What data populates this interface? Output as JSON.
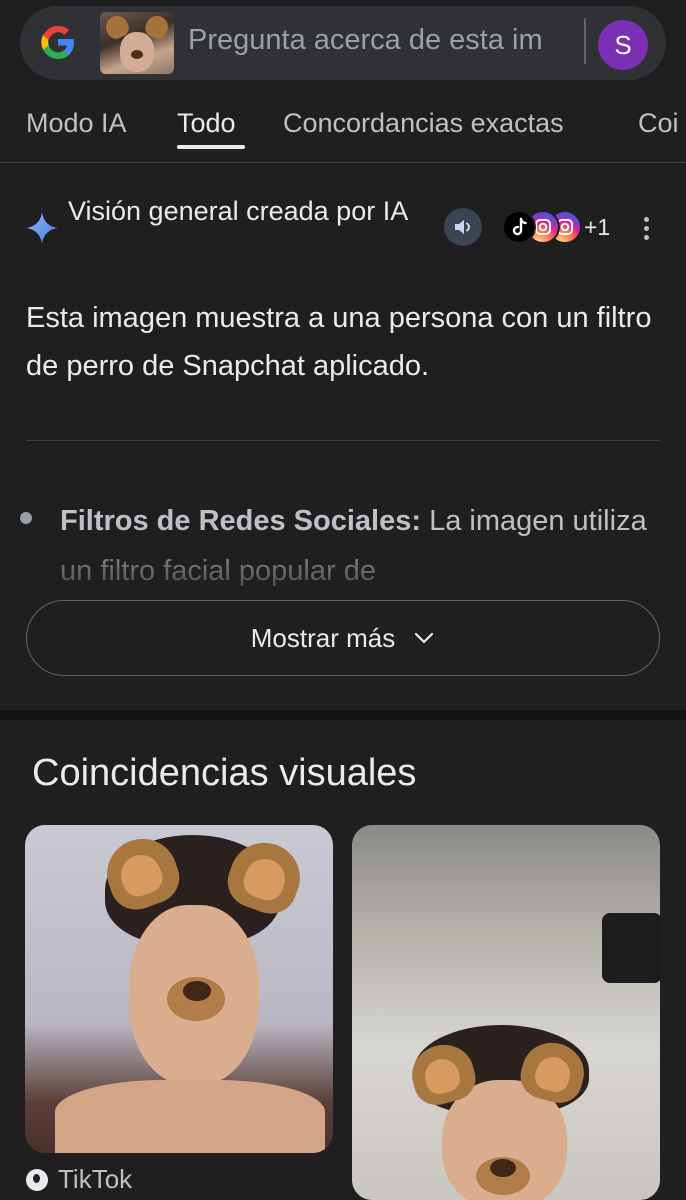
{
  "search": {
    "placeholder": "Pregunta acerca de esta im",
    "avatar_letter": "S"
  },
  "tabs": [
    {
      "label": "Modo IA"
    },
    {
      "label": "Todo"
    },
    {
      "label": "Concordancias exactas"
    },
    {
      "label": "Coi"
    }
  ],
  "ai_overview": {
    "title": "Visión general creada por IA",
    "sources_extra": "+1",
    "summary": "Esta imagen muestra a una persona con un filtro de perro de Snapchat aplicado.",
    "bullet_title": "Filtros de Redes Sociales:",
    "bullet_text": " La imagen utiliza un filtro facial popular de",
    "show_more": "Mostrar más"
  },
  "visual_matches": {
    "title": "Coincidencias visuales",
    "items": [
      {
        "source": "TikTok"
      }
    ]
  }
}
